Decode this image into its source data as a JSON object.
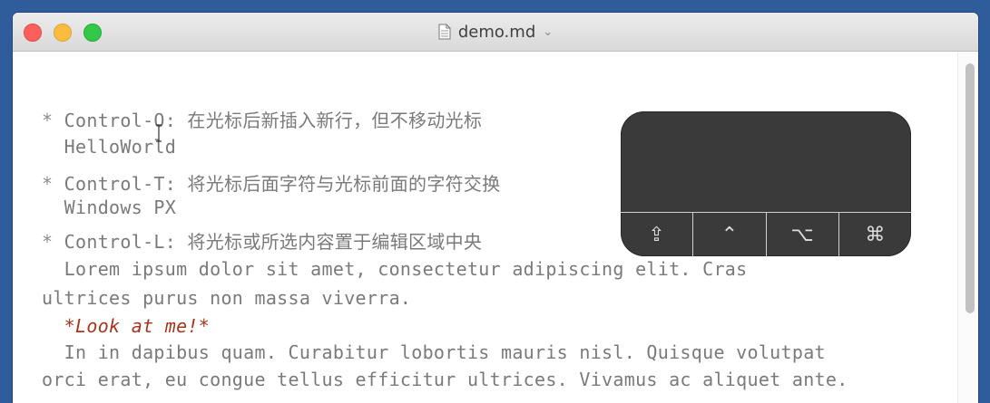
{
  "window": {
    "title": "demo.md",
    "title_chevron": "⌄"
  },
  "editor": {
    "lines": [
      {
        "bullet": "*",
        "text": " Control-O: 在光标后新插入新行，但不移动光标"
      },
      {
        "text": "  HelloWorld"
      },
      {
        "bullet": "*",
        "text": " Control-T: 将光标后面字符与光标前面的字符交换"
      },
      {
        "text": "  Windows PX"
      },
      {
        "bullet": "*",
        "text": " Control-L: 将光标或所选内容置于编辑区域中央"
      },
      {
        "text": "  Lorem ipsum dolor sit amet, consectetur adipiscing elit. Cras"
      },
      {
        "text": "ultrices purus non massa viverra."
      },
      {
        "emphasis": "  *Look at me!*"
      },
      {
        "text": "  In in dapibus quam. Curabitur lobortis mauris nisl. Quisque volutpat"
      },
      {
        "text": "orci erat, eu congue tellus efficitur ultrices. Vivamus ac aliquet ante."
      }
    ]
  },
  "touchbar": {
    "keys": [
      {
        "icon": "shift-icon",
        "glyph": "⇪"
      },
      {
        "icon": "control-icon",
        "glyph": "⌃"
      },
      {
        "icon": "option-icon",
        "glyph": "⌥"
      },
      {
        "icon": "command-icon",
        "glyph": "⌘"
      }
    ]
  },
  "colors": {
    "accent_emphasis": "#a5361d",
    "text": "#7a7a7a",
    "touchbar_bg": "#3a3a3a"
  }
}
